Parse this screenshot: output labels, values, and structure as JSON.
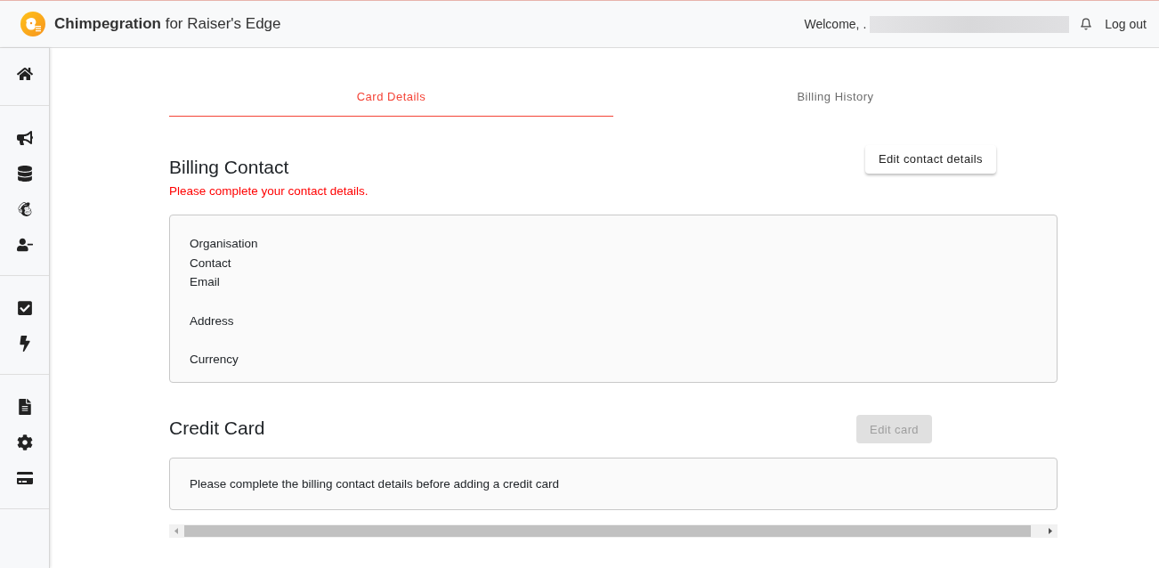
{
  "header": {
    "title": "**Chimpegration** for Raiser's Edge",
    "welcome": "Welcome, .",
    "logout": "Log out"
  },
  "tabs": [
    {
      "label": "Card Details",
      "selected": true
    },
    {
      "label": "Billing History",
      "selected": false
    }
  ],
  "billing_contact": {
    "title": "Billing Contact",
    "warning": "Please complete your contact details.",
    "button": {
      "label": "Edit contact details",
      "disabled": false
    },
    "fields": [
      {
        "label": "Organisation",
        "kind": "plain"
      },
      {
        "label": "Contact",
        "kind": "plain"
      },
      {
        "label": "Email",
        "kind": "plain"
      },
      {
        "label": "Address",
        "kind": "spaced"
      },
      {
        "label": "Currency",
        "kind": "spaced"
      }
    ]
  },
  "credit_card": {
    "title": "Credit Card",
    "button": {
      "label": "Edit card",
      "disabled": true
    },
    "message": "Please complete the billing contact details before adding a credit card"
  }
}
